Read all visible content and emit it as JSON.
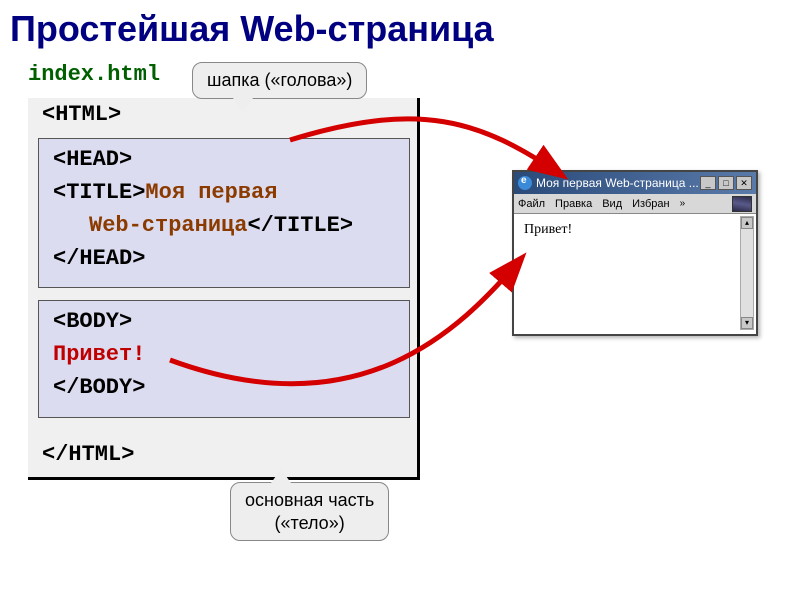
{
  "slide": {
    "title": "Простейшая Web-страница",
    "filename": "index.html"
  },
  "code": {
    "html_open": "<HTML>",
    "head_open": "<HEAD>",
    "title_open": "<TITLE>",
    "title_text1": "Моя первая",
    "title_text2": "Web-страница",
    "title_close": "</TITLE>",
    "head_close": "</HEAD>",
    "body_open": "<BODY>",
    "body_text": "Привет!",
    "body_close": "</BODY>",
    "html_close": "</HTML>"
  },
  "callouts": {
    "head": "шапка («голова»)",
    "body_line1": "основная часть",
    "body_line2": "(«тело»)"
  },
  "browser": {
    "window_title": "Моя первая Web-страница ...",
    "menu": {
      "file": "Файл",
      "edit": "Правка",
      "view": "Вид",
      "favorites": "Избран",
      "more": "»"
    },
    "content": "Привет!",
    "win_buttons": {
      "minimize": "_",
      "maximize": "□",
      "close": "✕"
    },
    "scrollbar": {
      "up": "▴",
      "down": "▾"
    }
  }
}
